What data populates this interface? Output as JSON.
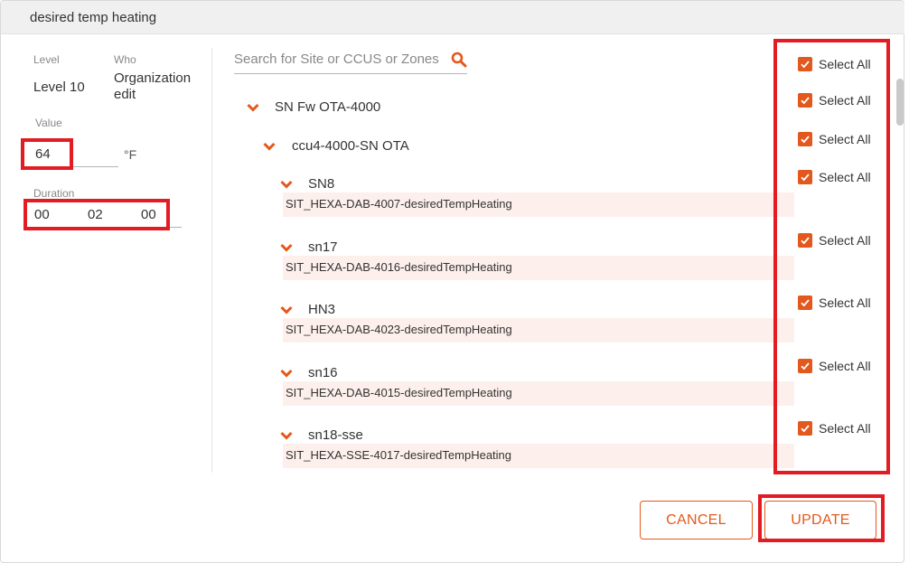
{
  "dialog": {
    "title": "desired temp heating"
  },
  "left": {
    "level_label": "Level",
    "level_value": "Level 10",
    "who_label": "Who",
    "who_value_line1": "Organization",
    "who_value_line2": "edit",
    "value_label": "Value",
    "value": "64",
    "unit": "°F",
    "duration_label": "Duration",
    "duration_hours": "00",
    "duration_minutes": "02",
    "duration_seconds": "00"
  },
  "search": {
    "placeholder": "Search for Site or CCUS or Zones"
  },
  "tree": {
    "site": "SN Fw OTA-4000",
    "ccu": "ccu4-4000-SN OTA",
    "zones": [
      {
        "name": "SN8",
        "point": "SIT_HEXA-DAB-4007-desiredTempHeating"
      },
      {
        "name": "sn17",
        "point": "SIT_HEXA-DAB-4016-desiredTempHeating"
      },
      {
        "name": "HN3",
        "point": "SIT_HEXA-DAB-4023-desiredTempHeating"
      },
      {
        "name": "sn16",
        "point": "SIT_HEXA-DAB-4015-desiredTempHeating"
      },
      {
        "name": "sn18-sse",
        "point": "SIT_HEXA-SSE-4017-desiredTempHeating"
      }
    ]
  },
  "select_all": {
    "label": "Select All",
    "items": [
      "Select All",
      "Select All",
      "Select All",
      "Select All",
      "Select All",
      "Select All",
      "Select All",
      "Select All"
    ]
  },
  "buttons": {
    "cancel": "CANCEL",
    "update": "UPDATE"
  },
  "colors": {
    "accent": "#e3581c",
    "highlight_box": "#e31b23",
    "zone_bar": "#fdf0ec"
  },
  "icons": {
    "search": "search-icon",
    "expand": "chevron-down-icon",
    "checkbox": "checkbox-checked-icon"
  }
}
